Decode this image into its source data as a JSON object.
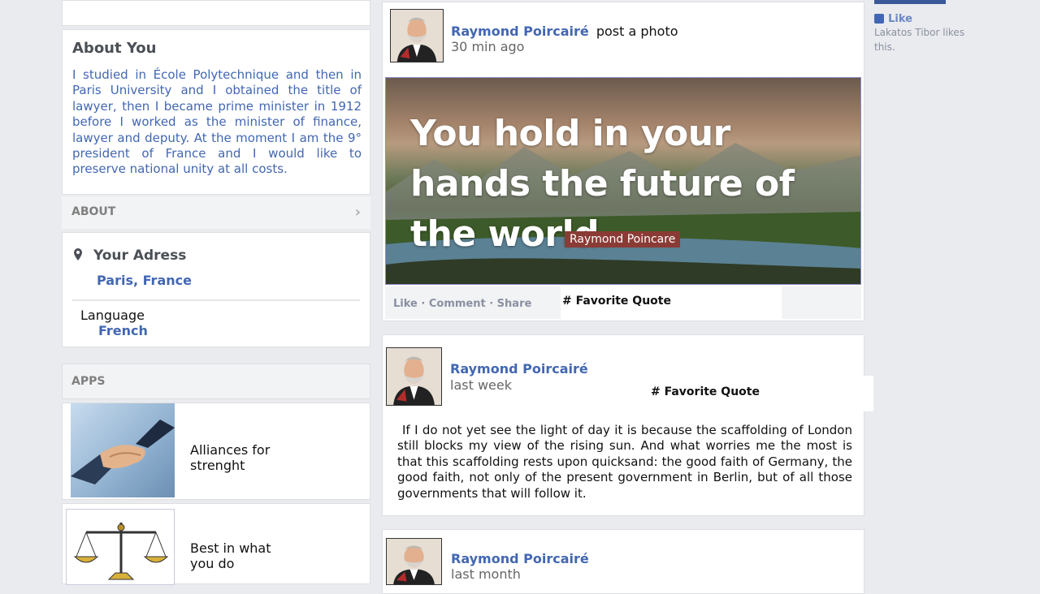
{
  "left": {
    "about_title": "About You",
    "about_text": "I studied in École Polytechnique and then in Paris University and I obtained the title of lawyer, then I became prime minister in 1912 before I worked as the minister of finance, lawyer and deputy. At the moment I am the 9° president of France and  I would like to preserve national unity at all costs.",
    "about_bar": "ABOUT",
    "address_label": "Your Adress",
    "address_value": "Paris, France",
    "language_label": "Language",
    "language_value": "French",
    "apps_label": "APPS",
    "apps": [
      {
        "label": "Alliances for strenght",
        "icon": "handshake-icon"
      },
      {
        "label": "Best in what you do",
        "icon": "scales-icon"
      }
    ]
  },
  "feed": {
    "posts": [
      {
        "author": "Raymond Poircairé",
        "action": "post a photo",
        "time": "30 min ago",
        "image_quote": "You hold in your hands the future of the world.",
        "image_caption": "Raymond Poincare",
        "actions": "Like · Comment · Share",
        "tag": "# Favorite Quote"
      },
      {
        "author": "Raymond Poircairé",
        "time": "last week",
        "tag": "# Favorite Quote",
        "text": "If I do not yet see the light of day it is because the scaffolding of London still blocks my view of the rising sun. And what worries me the most is that this scaffolding rests upon quicksand: the good faith of Germany, the good faith, not only of the present government in Berlin, but of all those governments that will follow it."
      },
      {
        "author": "Raymond Poircairé",
        "time": "last month"
      }
    ]
  },
  "right": {
    "like_label": "Like",
    "like_text": "Lakatos Tibor likes this."
  }
}
